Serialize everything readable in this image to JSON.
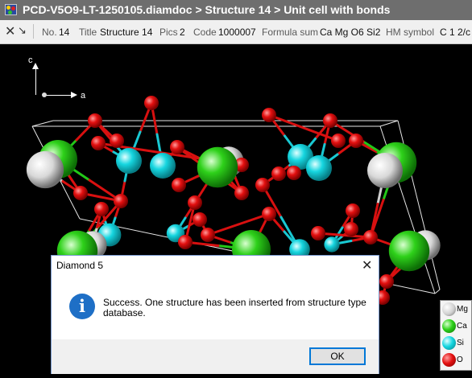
{
  "window": {
    "title": "PCD-V5O9-LT-1250105.diamdoc > Structure 14 > Unit cell with bonds"
  },
  "infobar": {
    "no_label": "No.",
    "no_value": "14",
    "title_label": "Title",
    "title_value": "Structure 14",
    "pics_label": "Pics",
    "pics_value": "2",
    "code_label": "Code",
    "code_value": "1000007",
    "formula_label": "Formula sum",
    "formula_value": "Ca Mg O6 Si2",
    "hm_label": "HM symbol",
    "hm_value": "C 1 2/c"
  },
  "axes": {
    "c": "c",
    "a": "a"
  },
  "legend": [
    {
      "element": "Mg",
      "color": "#e8e8e8"
    },
    {
      "element": "Ca",
      "color": "#2ecc18"
    },
    {
      "element": "Si",
      "color": "#1fd6e0"
    },
    {
      "element": "O",
      "color": "#e41010"
    }
  ],
  "dialog": {
    "title": "Diamond 5",
    "message": "Success. One structure has been inserted from structure type database.",
    "ok_label": "OK",
    "close_glyph": "✕",
    "info_glyph": "i"
  },
  "icons": {
    "close": "close-icon",
    "pin": "pin-arrow-icon",
    "info": "info-icon"
  }
}
